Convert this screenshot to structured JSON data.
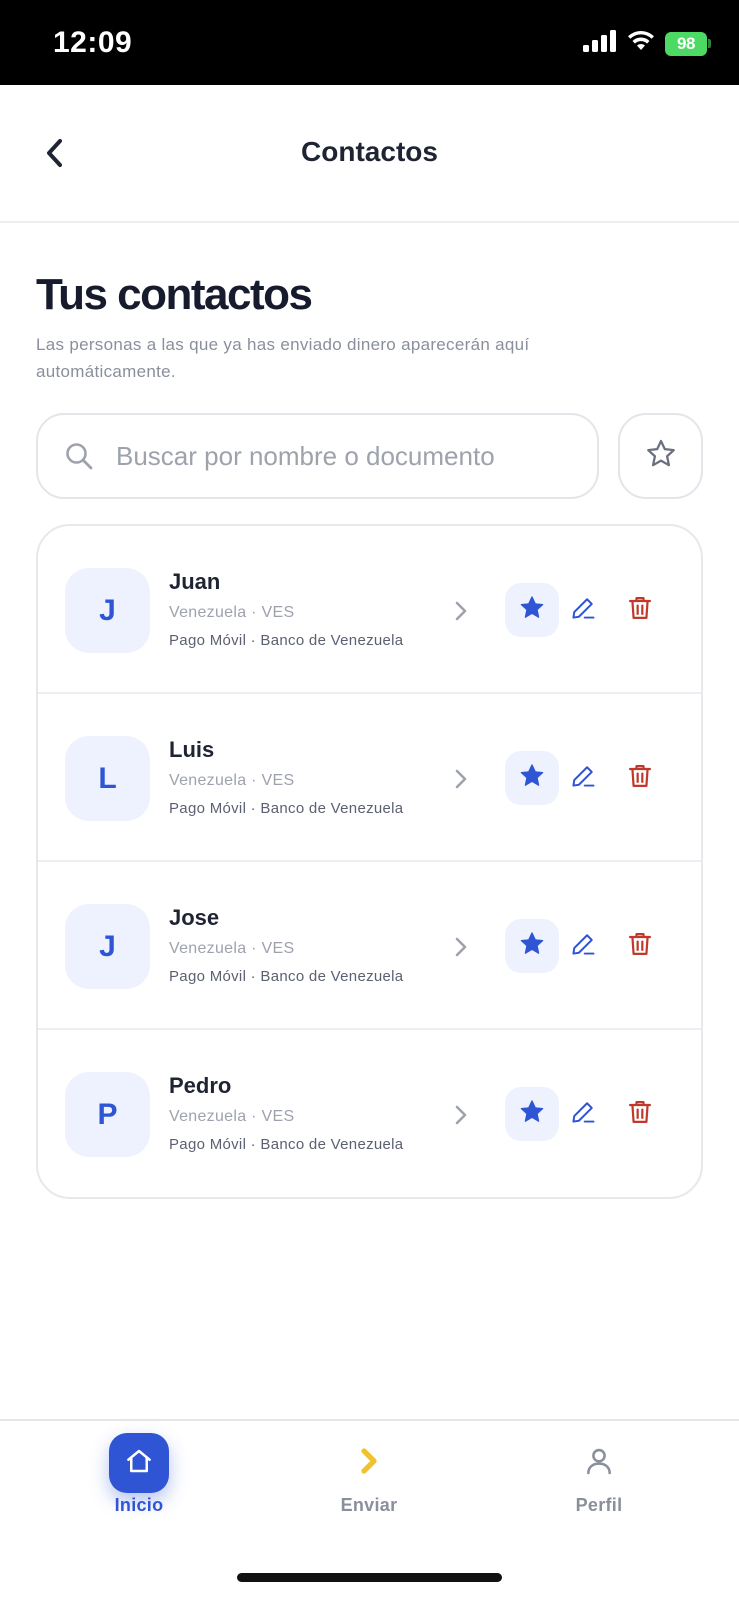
{
  "status_bar": {
    "time": "12:09",
    "battery": "98"
  },
  "header": {
    "title": "Contactos"
  },
  "section": {
    "title": "Tus contactos",
    "description": "Las personas a las que ya has enviado dinero aparecerán aquí automáticamente."
  },
  "search": {
    "placeholder": "Buscar por nombre o documento",
    "value": ""
  },
  "contacts": [
    {
      "initial": "J",
      "name": "Juan",
      "country": "Venezuela · VES",
      "method": "Pago Móvil · Banco de Venezuela"
    },
    {
      "initial": "L",
      "name": "Luis",
      "country": "Venezuela · VES",
      "method": "Pago Móvil · Banco de Venezuela"
    },
    {
      "initial": "J",
      "name": "Jose",
      "country": "Venezuela · VES",
      "method": "Pago Móvil · Banco de Venezuela"
    },
    {
      "initial": "P",
      "name": "Pedro",
      "country": "Venezuela · VES",
      "method": "Pago Móvil · Banco de Venezuela"
    }
  ],
  "nav": {
    "items": [
      {
        "label": "Inicio",
        "icon": "home-icon",
        "active": true
      },
      {
        "label": "Enviar",
        "icon": "send-chevron-icon",
        "active": false
      },
      {
        "label": "Perfil",
        "icon": "user-icon",
        "active": false
      }
    ]
  },
  "colors": {
    "accent": "#2f55d4",
    "accent_light": "#eef2fe",
    "danger": "#c0392b",
    "send_icon": "#f2c12e",
    "battery": "#4cd964"
  }
}
